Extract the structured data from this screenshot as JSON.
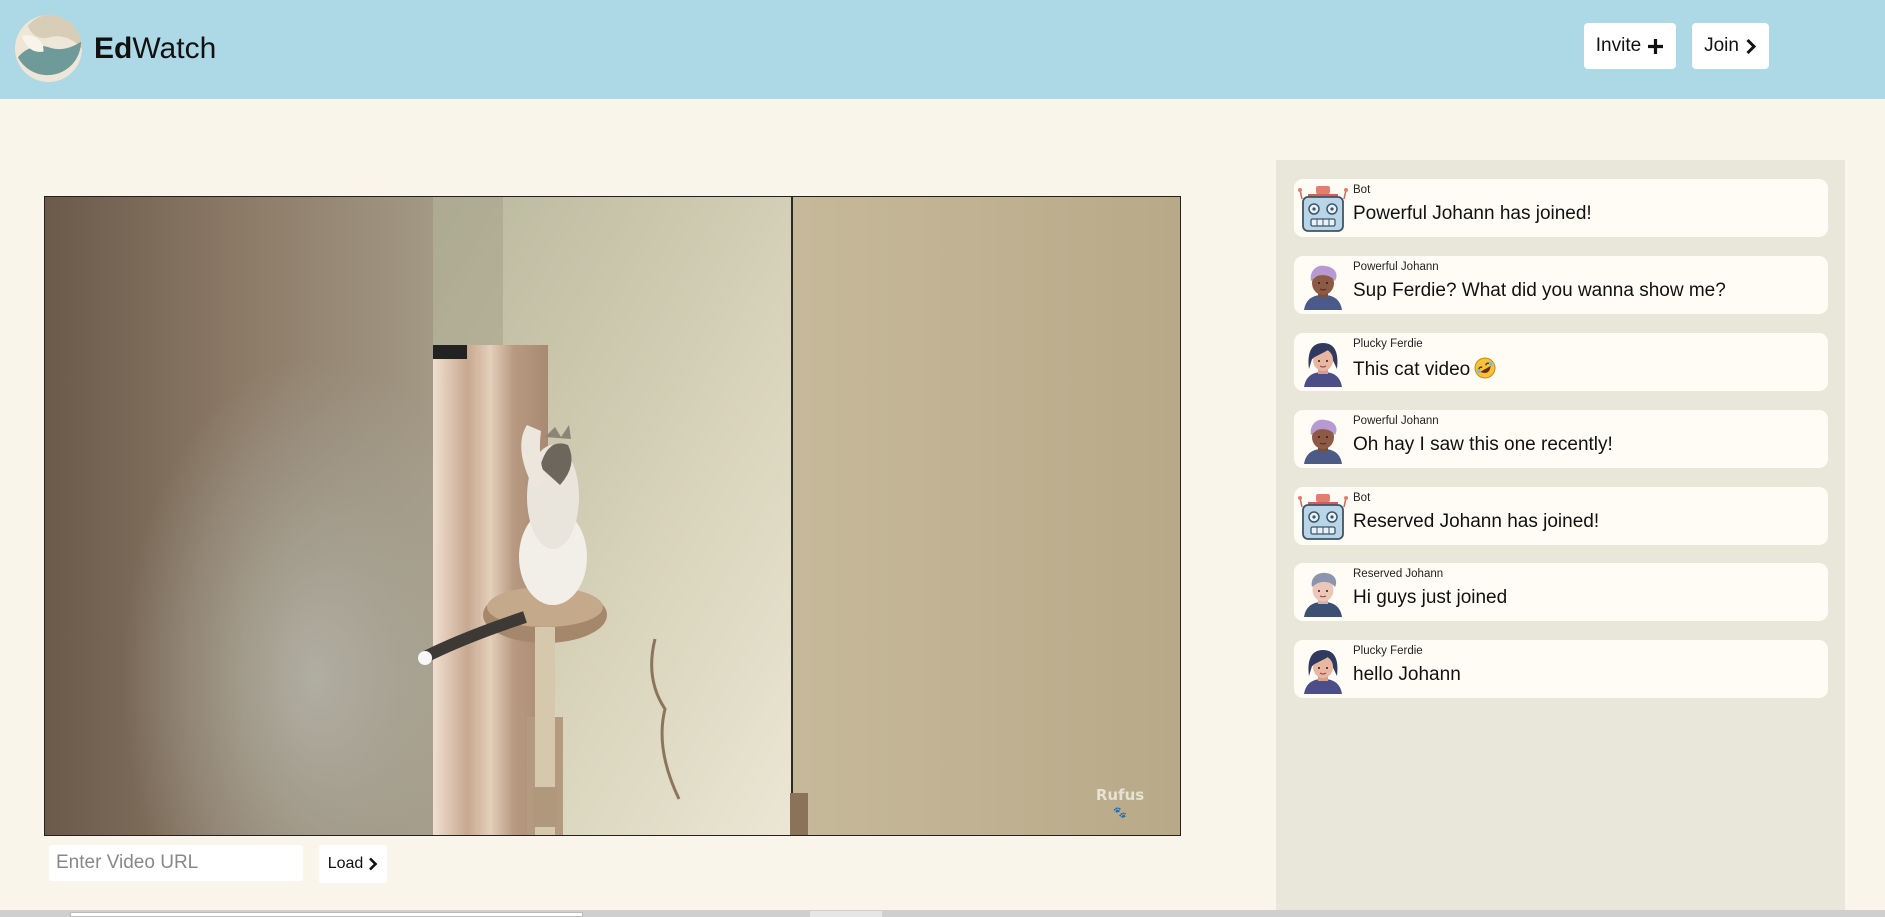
{
  "header": {
    "brand_bold": "Ed",
    "brand_rest": "Watch",
    "invite_label": "Invite",
    "join_label": "Join",
    "colors": {
      "background": "#add8e6",
      "button": "#ffffff"
    },
    "icons": {
      "invite": "plus-icon",
      "join": "chevron-right-icon",
      "logo": "edwatch-logo"
    }
  },
  "player": {
    "watermark": "Rufus",
    "url_placeholder": "Enter Video URL",
    "url_value": "",
    "load_label": "Load",
    "load_icon": "chevron-right-icon"
  },
  "chat": {
    "colors": {
      "panel": "#e9e6da",
      "bubble": "#fefcf4"
    },
    "messages": [
      {
        "user": "Bot",
        "avatar": "robot-avatar",
        "text": "Powerful Johann has joined!"
      },
      {
        "user": "Powerful Johann",
        "avatar": "person-avatar-purple-hair",
        "text": "Sup Ferdie? What did you wanna show me?"
      },
      {
        "user": "Plucky Ferdie",
        "avatar": "person-avatar-dark-hair",
        "text": "This cat video",
        "emoji": "rolling-on-floor-laughing-emoji"
      },
      {
        "user": "Powerful Johann",
        "avatar": "person-avatar-purple-hair",
        "text": "Oh hay I saw this one recently!"
      },
      {
        "user": "Bot",
        "avatar": "robot-avatar",
        "text": "Reserved Johann has joined!"
      },
      {
        "user": "Reserved Johann",
        "avatar": "person-avatar-grey-hair",
        "text": "Hi guys just joined"
      },
      {
        "user": "Plucky Ferdie",
        "avatar": "person-avatar-dark-hair",
        "text": "hello Johann"
      }
    ]
  }
}
